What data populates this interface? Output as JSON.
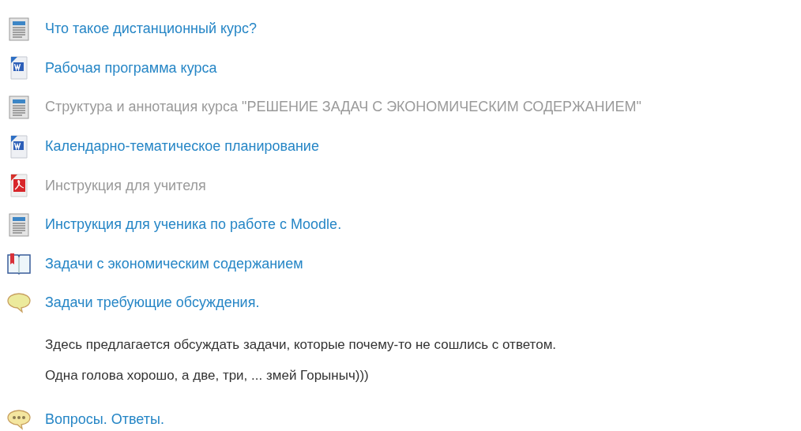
{
  "items": [
    {
      "kind": "page",
      "title": "Что такое дистанционный курс?",
      "dimmed": false
    },
    {
      "kind": "word",
      "title": "Рабочая программа курса",
      "dimmed": false
    },
    {
      "kind": "page",
      "title": "Структура и аннотация курса \"РЕШЕНИЕ ЗАДАЧ С ЭКОНОМИЧЕСКИМ СОДЕРЖАНИЕМ\"",
      "dimmed": true
    },
    {
      "kind": "word",
      "title": "Календарно-тематическое планирование",
      "dimmed": false
    },
    {
      "kind": "pdf",
      "title": "Инструкция для учителя",
      "dimmed": true
    },
    {
      "kind": "page",
      "title": "Инструкция для ученика по работе с Moodle.",
      "dimmed": false
    },
    {
      "kind": "book",
      "title": "Задачи с экономическим содержанием",
      "dimmed": false
    },
    {
      "kind": "forum",
      "title": "Задачи требующие обсуждения.",
      "dimmed": false,
      "description": [
        "Здесь предлагается обсуждать задачи, которые почему-то не сошлись с ответом.",
        "Одна голова хорошо, а две, три, ... змей Горыныч)))"
      ]
    },
    {
      "kind": "chat",
      "title": "Вопросы. Ответы.",
      "dimmed": false
    }
  ]
}
